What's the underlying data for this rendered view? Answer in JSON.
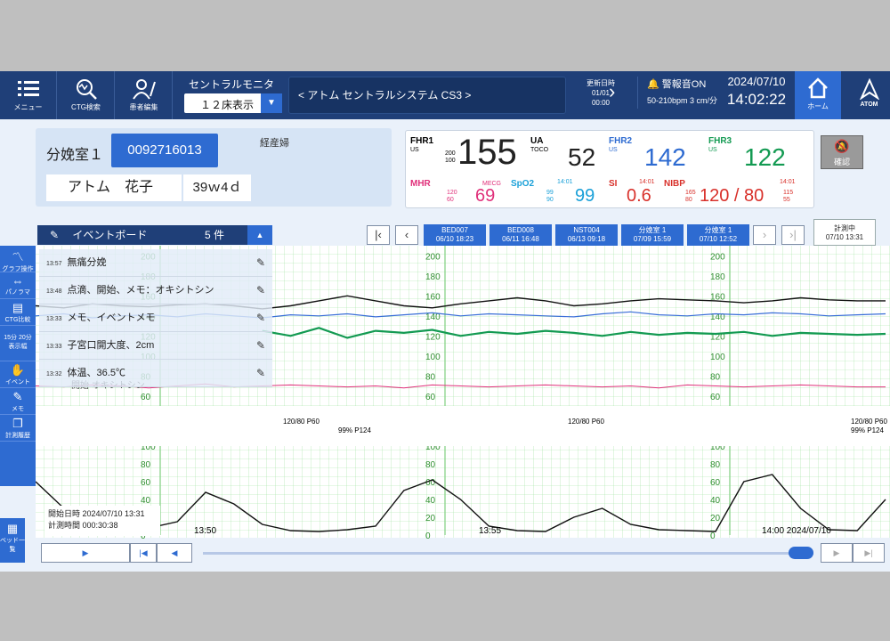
{
  "topbar": {
    "menu_label": "メニュー",
    "ctg_search_label": "CTG検索",
    "patient_edit_label": "患者編集",
    "central_monitor": "セントラルモニタ",
    "bed_display": "１２床表示",
    "system_title": "<  アトム セントラルシステム CS3  >",
    "update_label": "更新日時",
    "update_date": "01/01",
    "update_time": "00:00",
    "alarm_label": "警報音ON",
    "speed": "50-210bpm 3 cm/分",
    "date": "2024/07/10",
    "time": "14:02:22",
    "home_label": "ホーム",
    "brand": "ATOM"
  },
  "patient": {
    "room": "分娩室１",
    "id": "0092716013",
    "name": "アトム　花子",
    "weeks": "39ｗ4ｄ",
    "parity": "経産婦"
  },
  "vitals": {
    "fhr1_label": "FHR1",
    "fhr1_mode": "US",
    "fhr1_range_hi": "200",
    "fhr1_range_lo": "100",
    "fhr1_value": "155",
    "ua_label": "UA",
    "ua_mode": "TOCO",
    "ua_value": "52",
    "fhr2_label": "FHR2",
    "fhr2_mode": "US",
    "fhr2_value": "142",
    "fhr3_label": "FHR3",
    "fhr3_mode": "US",
    "fhr3_value": "122",
    "mhr_label": "MHR",
    "mhr_mode": "MECG",
    "mhr_hi": "120",
    "mhr_lo": "60",
    "mhr_value": "69",
    "spo2_label": "SpO2",
    "spo2_hi": "99",
    "spo2_lo": "90",
    "spo2_time": "14:01",
    "spo2_value": "99",
    "si_label": "SI",
    "si_time": "14:01",
    "si_value": "0.6",
    "nibp_label": "NIBP",
    "nibp_time": "14:01",
    "nibp_sys_hi": "165",
    "nibp_sys_lo": "80",
    "nibp_value": "120 /  80",
    "nibp_dia_hi": "115",
    "nibp_dia_lo": "55",
    "confirm_label": "確認"
  },
  "eventboard": {
    "title": "イベントボード",
    "count": "5 件",
    "events": [
      {
        "time": "13:57",
        "text": "無痛分娩"
      },
      {
        "time": "13:48",
        "text": "点滴、開始、メモ：オキシトシン"
      },
      {
        "time": "13:33",
        "text": "メモ、イベントメモ"
      },
      {
        "time": "13:33",
        "text": "子宮口開大度、2cm"
      },
      {
        "time": "13:32",
        "text": "体温、36.5℃"
      }
    ],
    "partial_event": "開始 オキシトシン"
  },
  "tabs": [
    {
      "bed": "BED007",
      "date": "06/10 18:23"
    },
    {
      "bed": "BED008",
      "date": "06/11 16:48"
    },
    {
      "bed": "NST004",
      "date": "06/13 09:18"
    },
    {
      "bed": "分娩室 1",
      "date": "07/09 15:59"
    },
    {
      "bed": "分娩室 1",
      "date": "07/10 12:52"
    }
  ],
  "current_tab": {
    "label": "計測中",
    "date": "07/10 13:31"
  },
  "sidetools": [
    "グラフ操作",
    "パノラマ",
    "CTG比較",
    "15分 20分 表示幅",
    "イベント",
    "メモ",
    "計測履歴"
  ],
  "bed_list_label": "ベッド一覧",
  "chart_annotations": {
    "bp1": "120/80 P60",
    "spo2_1": "99% P124",
    "bp2": "120/80 P60",
    "bp3": "120/80 P60",
    "spo2_2": "99% P124"
  },
  "time_labels": [
    "13:50",
    "13:55",
    "14:00 2024/07/10"
  ],
  "measure": {
    "start": "開始日時 2024/07/10 13:31",
    "elapsed": "計測時間 000:30:38"
  },
  "chart_data": {
    "type": "line",
    "fhr_axis_ticks": [
      60,
      80,
      100,
      120,
      140,
      160,
      180,
      200
    ],
    "ua_axis_ticks": [
      0,
      20,
      40,
      60,
      80,
      100
    ],
    "fhr1_bpm": [
      150,
      148,
      152,
      150,
      149,
      151,
      152,
      150,
      147,
      150,
      155,
      160,
      155,
      150,
      148,
      152,
      155,
      158,
      155,
      150,
      152,
      155,
      157,
      156,
      155,
      153,
      155,
      158,
      156,
      155,
      155
    ],
    "fhr2_bpm": [
      140,
      142,
      138,
      140,
      141,
      139,
      142,
      140,
      138,
      141,
      140,
      142,
      139,
      141,
      143,
      140,
      142,
      141,
      140,
      139,
      142,
      144,
      141,
      140,
      142,
      141,
      143,
      142,
      140,
      141,
      142
    ],
    "fhr3_bpm": [
      null,
      null,
      null,
      null,
      null,
      null,
      null,
      null,
      125,
      120,
      128,
      118,
      125,
      123,
      126,
      120,
      124,
      122,
      125,
      123,
      120,
      124,
      121,
      123,
      122,
      124,
      120,
      123,
      122,
      121,
      122
    ],
    "mhr_bpm": [
      70,
      69,
      71,
      70,
      68,
      70,
      72,
      69,
      70,
      71,
      70,
      69,
      70,
      68,
      71,
      70,
      69,
      70,
      71,
      70,
      69,
      70,
      68,
      71,
      70,
      69,
      70,
      71,
      70,
      69,
      69
    ],
    "ua_mmhg": [
      60,
      30,
      10,
      5,
      8,
      15,
      48,
      35,
      12,
      5,
      4,
      6,
      10,
      50,
      62,
      40,
      10,
      5,
      4,
      20,
      30,
      12,
      6,
      5,
      4,
      60,
      68,
      30,
      6,
      5,
      40
    ]
  }
}
